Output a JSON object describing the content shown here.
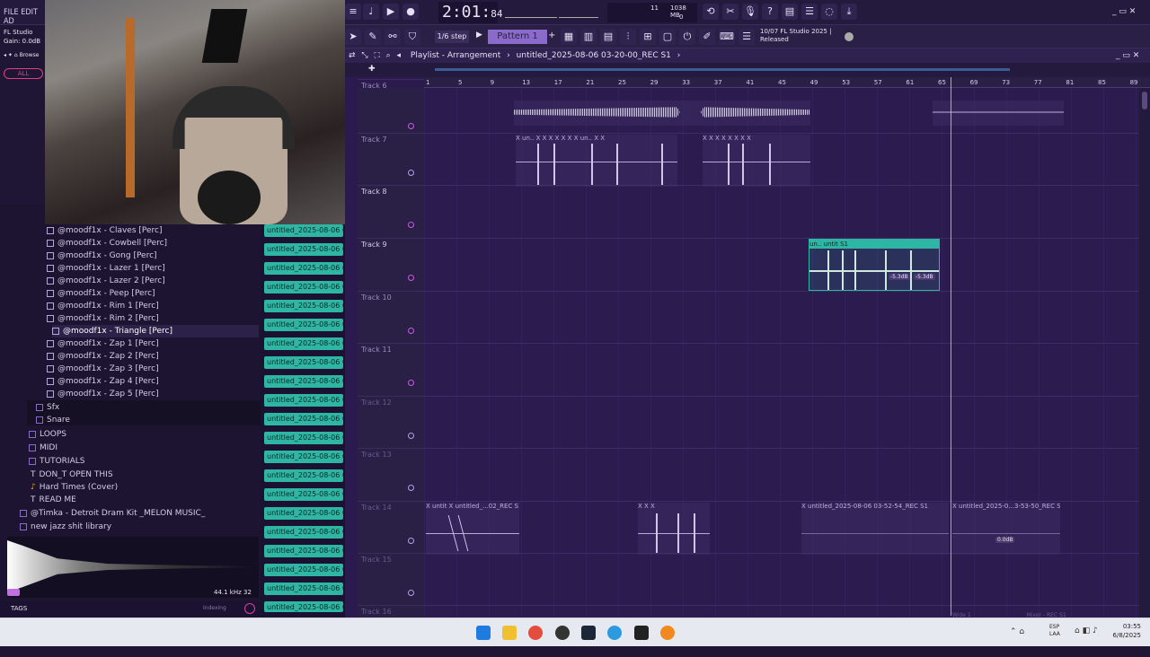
{
  "menu": {
    "file_edit": "FILE EDIT AD"
  },
  "app_info": {
    "app_name": "FL Studio",
    "gain": "Gain: 0.0dB",
    "browser_label": "Browse",
    "all_label": "ALL"
  },
  "transport": {
    "time": "2:01",
    "time_ms": "84",
    "cpu_mem": "1038 MB",
    "cpu_a": "11",
    "cpu_b": "0"
  },
  "toolbar": {
    "step": "1/6 step",
    "pattern": "Pattern 1",
    "news_line1": "10/07  FL Studio 2025 |",
    "news_line2": "Released"
  },
  "playlist": {
    "header": "Playlist - Arrangement",
    "file": "untitled_2025-08-06 03-20-00_REC S1",
    "ruler": [
      "1",
      "5",
      "9",
      "13",
      "17",
      "21",
      "25",
      "29",
      "33",
      "37",
      "41",
      "45",
      "49",
      "53",
      "57",
      "61",
      "65",
      "69",
      "73",
      "77",
      "81",
      "85",
      "89"
    ]
  },
  "tracks": [
    {
      "name": "Track 6"
    },
    {
      "name": "Track 7"
    },
    {
      "name": "Track 8"
    },
    {
      "name": "Track 9"
    },
    {
      "name": "Track 10"
    },
    {
      "name": "Track 11"
    },
    {
      "name": "Track 12"
    },
    {
      "name": "Track 13"
    },
    {
      "name": "Track 14"
    },
    {
      "name": "Track 15"
    },
    {
      "name": "Track 16"
    }
  ],
  "clips": {
    "track7_a": "X un.. X   X   X  X X  X  X un.. X X",
    "track7_b": "X   X X X  X  X   X  X",
    "teal": "un.. untit S1",
    "teal_db1": "-5.3dB",
    "teal_db2": "-5.3dB",
    "track14_a": "X untit  X untitled_...02_REC S1",
    "track14_b": "X   X  X",
    "track14_c": "X untitled_2025-08-06 03-52-54_REC S1",
    "track14_d": "X untitled_2025-0...3-53-50_REC S1",
    "db_marker": "0.0dB"
  },
  "browser": {
    "items": [
      "@moodf1x - Claves [Perc]",
      "@moodf1x - Cowbell [Perc]",
      "@moodf1x - Gong [Perc]",
      "@moodf1x - Lazer 1 [Perc]",
      "@moodf1x - Lazer 2 [Perc]",
      "@moodf1x - Peep [Perc]",
      "@moodf1x - Rim 1 [Perc]",
      "@moodf1x - Rim 2 [Perc]",
      "@moodf1x - Triangle [Perc]",
      "@moodf1x - Zap 1 [Perc]",
      "@moodf1x - Zap 2 [Perc]",
      "@moodf1x - Zap 3 [Perc]",
      "@moodf1x - Zap 4 [Perc]",
      "@moodf1x - Zap 5 [Perc]"
    ],
    "folders": [
      "Sfx",
      "Snare"
    ],
    "top_folders": [
      "LOOPS",
      "MIDI",
      "TUTORIALS",
      "DON_T OPEN THIS",
      "Hard Times (Cover)",
      "READ ME"
    ],
    "packs": [
      "@Timka - Detroit Dram Kit _MELON MUSIC_",
      "new jazz shit library"
    ],
    "sample_rate": "44.1 kHz 32",
    "tags": "TAGS",
    "indexing": "Indexing"
  },
  "clip_list": {
    "label": "untitled_2025-08-06 03-"
  },
  "taskbar": {
    "lang": "ESP",
    "lang2": "LAA",
    "time": "03:55",
    "date": "6/8/2025",
    "wide": "Wide 1",
    "mixer": "Mixer - REC S1"
  },
  "colors": {
    "accent": "#8a6acb",
    "teal": "#2fb5a3",
    "bg": "#2a1a4d"
  }
}
